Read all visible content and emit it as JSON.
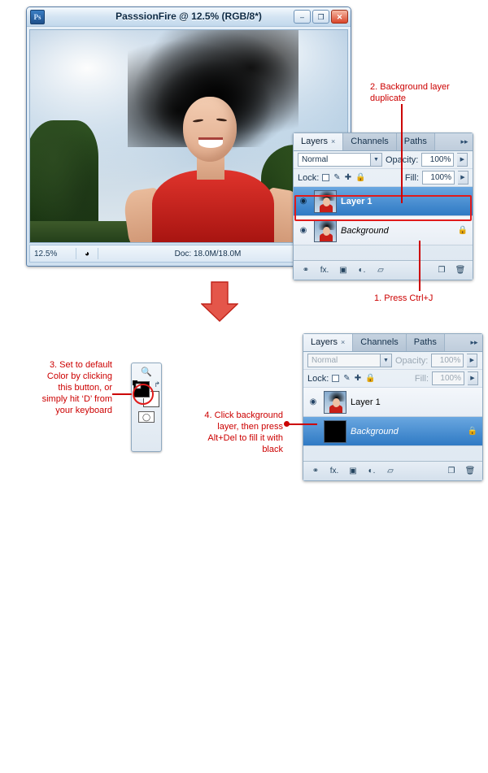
{
  "document_window": {
    "title": "PasssionFire @ 12.5% (RGB/8*)",
    "app_icon": "photoshop-icon",
    "window_buttons": [
      {
        "name": "minimize-button",
        "glyph": "–"
      },
      {
        "name": "maximize-button",
        "glyph": "❐"
      },
      {
        "name": "close-button",
        "glyph": "✕"
      }
    ],
    "status_bar": {
      "zoom": "12.5%",
      "doc_info": "Doc: 18.0M/18.0M",
      "arrow_glyph": "▸",
      "extra_glyph": "◂"
    }
  },
  "layers_panel_top": {
    "tabs": [
      {
        "label": "Layers",
        "close": "×",
        "active": true
      },
      {
        "label": "Channels",
        "active": false
      },
      {
        "label": "Paths",
        "active": false
      }
    ],
    "menu_glyph": "▸▸",
    "blend_mode": "Normal",
    "opacity_label": "Opacity:",
    "opacity_value": "100%",
    "lock_label": "Lock:",
    "fill_label": "Fill:",
    "fill_value": "100%",
    "lock_icons": [
      "□",
      "✒",
      "✚",
      "🔒"
    ],
    "layers": [
      {
        "name": "Layer 1",
        "visible": "◉",
        "selected": true,
        "style": "bold",
        "thumb": "photo",
        "locked": ""
      },
      {
        "name": "Background",
        "visible": "◉",
        "selected": false,
        "style": "italic",
        "thumb": "photo",
        "locked": "🔒"
      }
    ],
    "footer_icons": [
      "link-icon",
      "fx-icon",
      "mask-icon",
      "adjustment-icon",
      "group-icon",
      "new-layer-icon",
      "delete-icon"
    ],
    "footer_glyphs": [
      "⚭",
      "fx.",
      "▣",
      "◐.",
      "▱",
      "❐",
      "🗑"
    ]
  },
  "layers_panel_bottom": {
    "tabs": [
      {
        "label": "Layers",
        "close": "×",
        "active": true
      },
      {
        "label": "Channels",
        "active": false
      },
      {
        "label": "Paths",
        "active": false
      }
    ],
    "menu_glyph": "▸▸",
    "blend_mode": "Normal",
    "opacity_label": "Opacity:",
    "opacity_value": "100%",
    "lock_label": "Lock:",
    "fill_label": "Fill:",
    "fill_value": "100%",
    "lock_icons": [
      "□",
      "✒",
      "✚",
      "🔒"
    ],
    "layers": [
      {
        "name": "Layer 1",
        "visible": "◉",
        "selected": false,
        "style": "normal",
        "thumb": "photo",
        "locked": ""
      },
      {
        "name": "Background",
        "visible": "",
        "selected": true,
        "style": "italic",
        "thumb": "black",
        "locked": "🔒"
      }
    ],
    "footer_glyphs": [
      "⚭",
      "fx.",
      "▣",
      "◐.",
      "▱",
      "❐",
      "🗑"
    ]
  },
  "toolbar_fragment": {
    "zoom_tool_glyph": "🔍",
    "reset_glyph": "↱",
    "default_swatch_name": "default-colors-icon",
    "foreground_color": "#000000",
    "background_color": "#ffffff",
    "quickmask_glyph": "◯"
  },
  "annotations": [
    {
      "id": "a2",
      "text": "2. Background layer\nduplicate"
    },
    {
      "id": "a1",
      "text": "1. Press Ctrl+J"
    },
    {
      "id": "a3",
      "text": "3. Set to default\nColor by clicking\nthis button, or\nsimply hit ‘D’ from\nyour keyboard"
    },
    {
      "id": "a4",
      "text": "4. Click background\nlayer, then press\nAlt+Del to fill it with\nblack"
    }
  ],
  "colors": {
    "annotation_red": "#cc0000",
    "highlight_red": "#e01b1b",
    "arrow_red": "#e03a30",
    "selected_layer_blue": "#2f7ac4"
  }
}
